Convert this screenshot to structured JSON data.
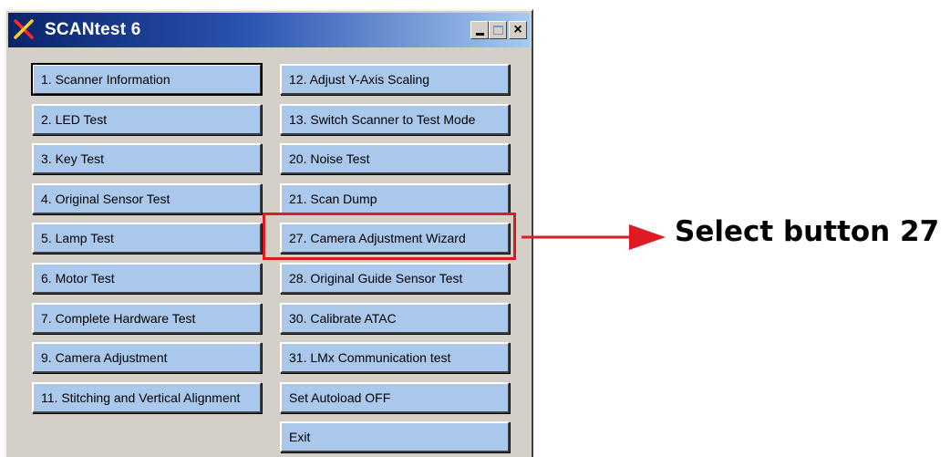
{
  "window": {
    "title": "SCANtest 6",
    "controls": {
      "minimize_icon": "minimize-icon",
      "maximize_icon": "maximize-icon",
      "close_label": "×"
    }
  },
  "left_buttons": [
    {
      "label": "1. Scanner Information",
      "default": true
    },
    {
      "label": "2. LED Test"
    },
    {
      "label": "3. Key Test"
    },
    {
      "label": "4. Original Sensor Test"
    },
    {
      "label": "5. Lamp Test"
    },
    {
      "label": "6. Motor Test"
    },
    {
      "label": "7. Complete Hardware Test"
    },
    {
      "label": "9. Camera Adjustment"
    },
    {
      "label": "11. Stitching and Vertical Alignment"
    }
  ],
  "right_buttons": [
    {
      "label": "12. Adjust Y-Axis Scaling"
    },
    {
      "label": "13. Switch Scanner to Test Mode"
    },
    {
      "label": "20. Noise Test"
    },
    {
      "label": "21. Scan Dump"
    },
    {
      "label": "27. Camera Adjustment Wizard",
      "highlighted": true
    },
    {
      "label": "28. Original Guide Sensor Test"
    },
    {
      "label": "30. Calibrate ATAC"
    },
    {
      "label": "31. LMx Communication test"
    },
    {
      "label": "Set Autoload OFF"
    },
    {
      "label": "Exit"
    }
  ],
  "annotation": {
    "text": "Select button 27",
    "color": "#e01a22"
  },
  "colors": {
    "button_face": "#aac8ec",
    "window_face": "#d4d0c8",
    "title_start": "#0a246a",
    "title_end": "#a6caf0"
  }
}
